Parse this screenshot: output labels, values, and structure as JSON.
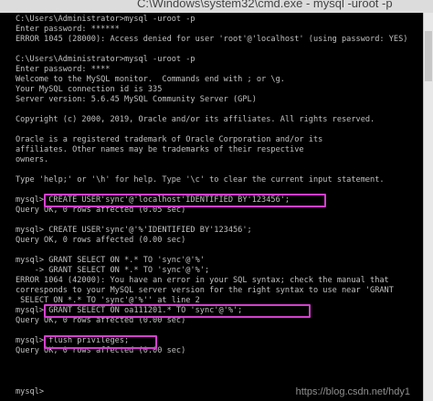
{
  "window": {
    "title": "C:\\Windows\\system32\\cmd.exe - mysql -uroot -p"
  },
  "console": {
    "lines": [
      "C:\\Users\\Administrator>mysql -uroot -p",
      "Enter password: ******",
      "ERROR 1045 (28000): Access denied for user 'root'@'localhost' (using password: YES)",
      "",
      "C:\\Users\\Administrator>mysql -uroot -p",
      "Enter password: ****",
      "Welcome to the MySQL monitor.  Commands end with ; or \\g.",
      "Your MySQL connection id is 335",
      "Server version: 5.6.45 MySQL Community Server (GPL)",
      "",
      "Copyright (c) 2000, 2019, Oracle and/or its affiliates. All rights reserved.",
      "",
      "Oracle is a registered trademark of Oracle Corporation and/or its",
      "affiliates. Other names may be trademarks of their respective",
      "owners.",
      "",
      "Type 'help;' or '\\h' for help. Type '\\c' to clear the current input statement.",
      "",
      "mysql> CREATE USER'sync'@'localhost'IDENTIFIED BY'123456';",
      "Query OK, 0 rows affected (0.05 sec)",
      "",
      "mysql> CREATE USER'sync'@'%'IDENTIFIED BY'123456';",
      "Query OK, 0 rows affected (0.00 sec)",
      "",
      "mysql> GRANT SELECT ON *.* TO 'sync'@'%'",
      "    -> GRANT SELECT ON *.* TO 'sync'@'%';",
      "ERROR 1064 (42000): You have an error in your SQL syntax; check the manual that",
      "corresponds to your MySQL server version for the right syntax to use near 'GRANT",
      " SELECT ON *.* TO 'sync'@'%'' at line 2",
      "mysql> GRANT SELECT ON oa111201.* TO 'sync'@'%';",
      "Query OK, 0 rows affected (0.00 sec)",
      "",
      "mysql> flush privileges;",
      "Query OK, 0 rows affected (0.00 sec)",
      "",
      "mysql>"
    ]
  },
  "watermark": "https://blog.csdn.net/hdy1"
}
